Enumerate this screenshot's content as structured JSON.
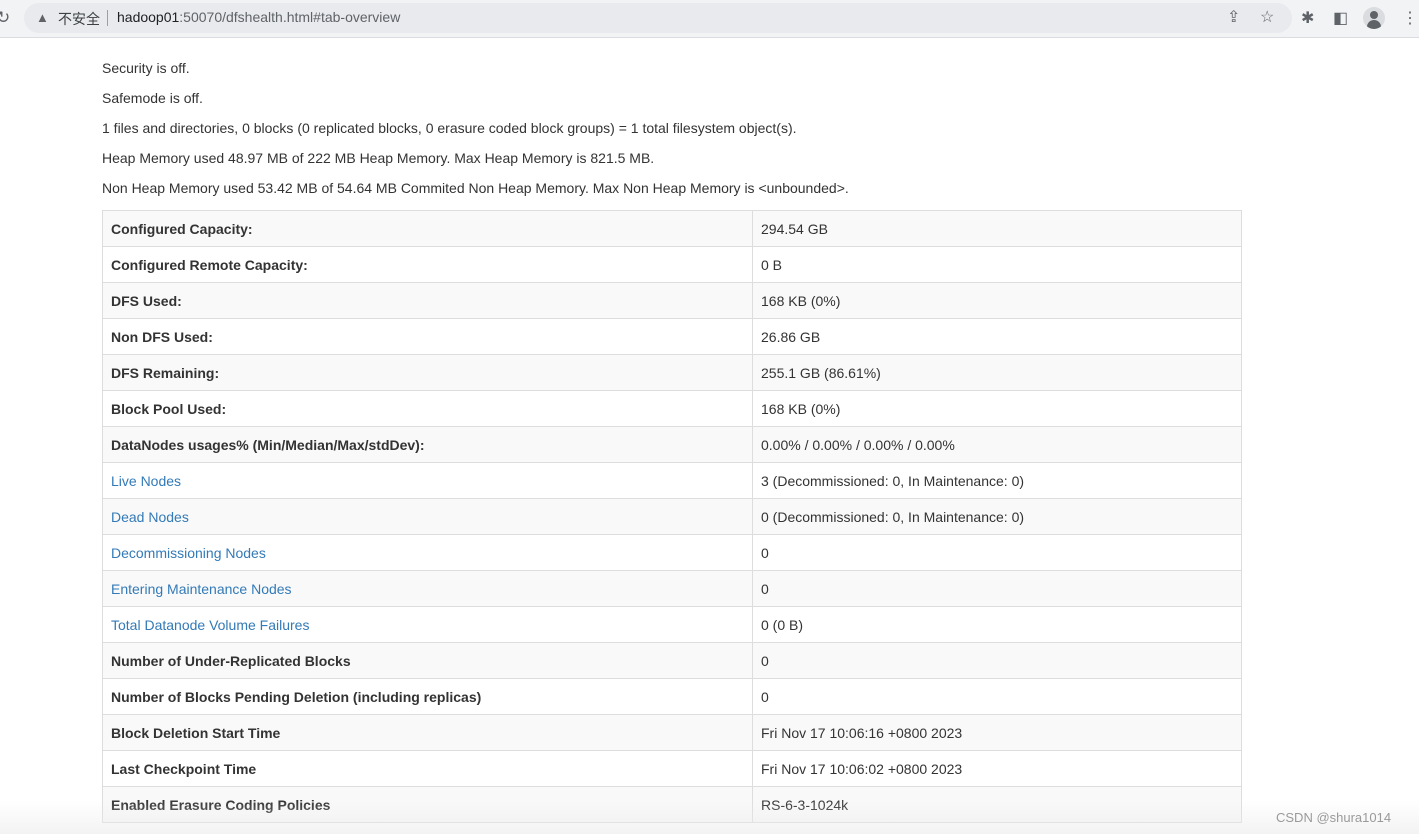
{
  "browser": {
    "security_label": "不安全",
    "url_host": "hadoop01",
    "url_rest": ":50070/dfshealth.html#tab-overview"
  },
  "summary": {
    "security": "Security is off.",
    "safemode": "Safemode is off.",
    "files": "1 files and directories, 0 blocks (0 replicated blocks, 0 erasure coded block groups) = 1 total filesystem object(s).",
    "heap": "Heap Memory used 48.97 MB of 222 MB Heap Memory. Max Heap Memory is 821.5 MB.",
    "non_heap": "Non Heap Memory used 53.42 MB of 54.64 MB Commited Non Heap Memory. Max Non Heap Memory is <unbounded>."
  },
  "table": {
    "rows": [
      {
        "label": "Configured Capacity:",
        "value": "294.54 GB",
        "link": false
      },
      {
        "label": "Configured Remote Capacity:",
        "value": "0 B",
        "link": false
      },
      {
        "label": "DFS Used:",
        "value": "168 KB (0%)",
        "link": false
      },
      {
        "label": "Non DFS Used:",
        "value": "26.86 GB",
        "link": false
      },
      {
        "label": "DFS Remaining:",
        "value": "255.1 GB (86.61%)",
        "link": false
      },
      {
        "label": "Block Pool Used:",
        "value": "168 KB (0%)",
        "link": false
      },
      {
        "label": "DataNodes usages% (Min/Median/Max/stdDev):",
        "value": "0.00% / 0.00% / 0.00% / 0.00%",
        "link": false
      },
      {
        "label": "Live Nodes",
        "value": "3 (Decommissioned: 0, In Maintenance: 0)",
        "link": true
      },
      {
        "label": "Dead Nodes",
        "value": "0 (Decommissioned: 0, In Maintenance: 0)",
        "link": true
      },
      {
        "label": "Decommissioning Nodes",
        "value": "0",
        "link": true
      },
      {
        "label": "Entering Maintenance Nodes",
        "value": "0",
        "link": true
      },
      {
        "label": "Total Datanode Volume Failures",
        "value": "0 (0 B)",
        "link": true
      },
      {
        "label": "Number of Under-Replicated Blocks",
        "value": "0",
        "link": false
      },
      {
        "label": "Number of Blocks Pending Deletion (including replicas)",
        "value": "0",
        "link": false
      },
      {
        "label": "Block Deletion Start Time",
        "value": "Fri Nov 17 10:06:16 +0800 2023",
        "link": false
      },
      {
        "label": "Last Checkpoint Time",
        "value": "Fri Nov 17 10:06:02 +0800 2023",
        "link": false
      },
      {
        "label": "Enabled Erasure Coding Policies",
        "value": "RS-6-3-1024k",
        "link": false
      }
    ]
  },
  "watermark": "CSDN @shura1014"
}
